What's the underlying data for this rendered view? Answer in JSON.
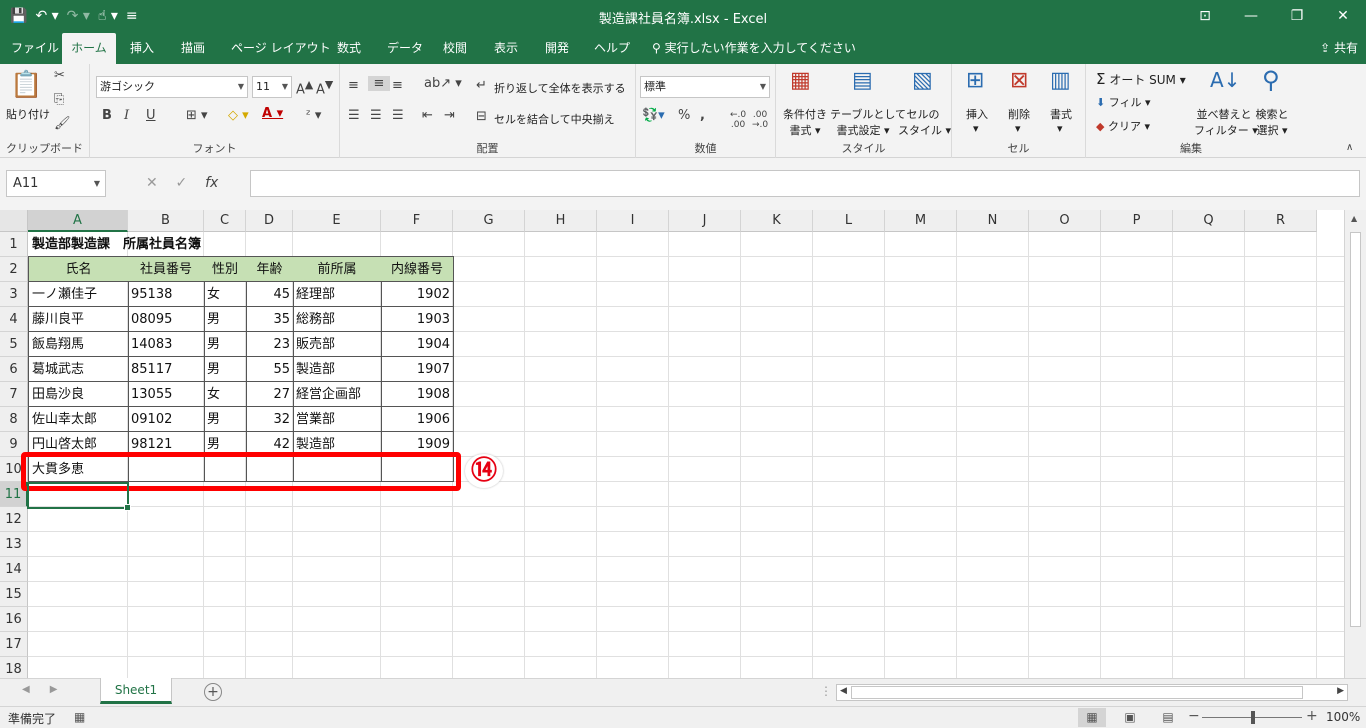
{
  "window": {
    "title": "製造課社員名簿.xlsx  -  Excel",
    "qat_icons": [
      "save-icon",
      "undo-icon",
      "redo-icon",
      "touch-mode-icon",
      "customize-icon"
    ]
  },
  "tabs": [
    "ファイル",
    "ホーム",
    "挿入",
    "描画",
    "ページ レイアウト",
    "数式",
    "データ",
    "校閲",
    "表示",
    "開発",
    "ヘルプ"
  ],
  "active_tab": "ホーム",
  "tell_me": "実行したい作業を入力してください",
  "share": "共有",
  "ribbon": {
    "clipboard": {
      "paste": "貼り付け",
      "label": "クリップボード"
    },
    "font": {
      "name": "游ゴシック",
      "size": "11",
      "bold": "B",
      "italic": "I",
      "underline": "U",
      "label": "フォント"
    },
    "alignment": {
      "wrap": "折り返して全体を表示する",
      "merge": "セルを結合して中央揃え",
      "label": "配置"
    },
    "number": {
      "format": "標準",
      "percent": "%",
      "comma": ",",
      "label": "数値"
    },
    "styles": {
      "conditional": [
        "条件付き",
        "書式"
      ],
      "table": [
        "テーブルとして",
        "書式設定"
      ],
      "cell_styles": [
        "セルの",
        "スタイル"
      ],
      "label": "スタイル"
    },
    "cells": {
      "insert": "挿入",
      "delete": "削除",
      "format": "書式",
      "label": "セル"
    },
    "editing": {
      "autosum": "オート SUM",
      "fill": "フィル",
      "clear": "クリア",
      "sort": [
        "並べ替えと",
        "フィルター"
      ],
      "find": [
        "検索と",
        "選択"
      ],
      "label": "編集"
    }
  },
  "formula_bar": {
    "name_box": "A11",
    "fx": "fx",
    "value": ""
  },
  "columns": [
    "A",
    "B",
    "C",
    "D",
    "E",
    "F",
    "G",
    "H",
    "I",
    "J",
    "K",
    "L",
    "M",
    "N",
    "O",
    "P",
    "Q",
    "R"
  ],
  "rows": [
    "1",
    "2",
    "3",
    "4",
    "5",
    "6",
    "7",
    "8",
    "9",
    "10",
    "11",
    "12",
    "13",
    "14",
    "15",
    "16",
    "17",
    "18"
  ],
  "sheet": {
    "title": "製造部製造課　所属社員名簿",
    "headers": [
      "氏名",
      "社員番号",
      "性別",
      "年齢",
      "前所属",
      "内線番号"
    ],
    "records": [
      [
        "一ノ瀬佳子",
        "95138",
        "女",
        "45",
        "経理部",
        "1902"
      ],
      [
        "藤川良平",
        "08095",
        "男",
        "35",
        "総務部",
        "1903"
      ],
      [
        "飯島翔馬",
        "14083",
        "男",
        "23",
        "販売部",
        "1904"
      ],
      [
        "葛城武志",
        "85117",
        "男",
        "55",
        "製造部",
        "1907"
      ],
      [
        "田島沙良",
        "13055",
        "女",
        "27",
        "経営企画部",
        "1908"
      ],
      [
        "佐山幸太郎",
        "09102",
        "男",
        "32",
        "営業部",
        "1906"
      ],
      [
        "円山啓太郎",
        "98121",
        "男",
        "42",
        "製造部",
        "1909"
      ],
      [
        "大貫多恵",
        "",
        "",
        "",
        "",
        ""
      ]
    ]
  },
  "annotation": {
    "marker": "⑭",
    "color": "#ff0000"
  },
  "sheet_tabs": [
    "Sheet1"
  ],
  "status": {
    "text": "準備完了",
    "zoom": "100%"
  }
}
